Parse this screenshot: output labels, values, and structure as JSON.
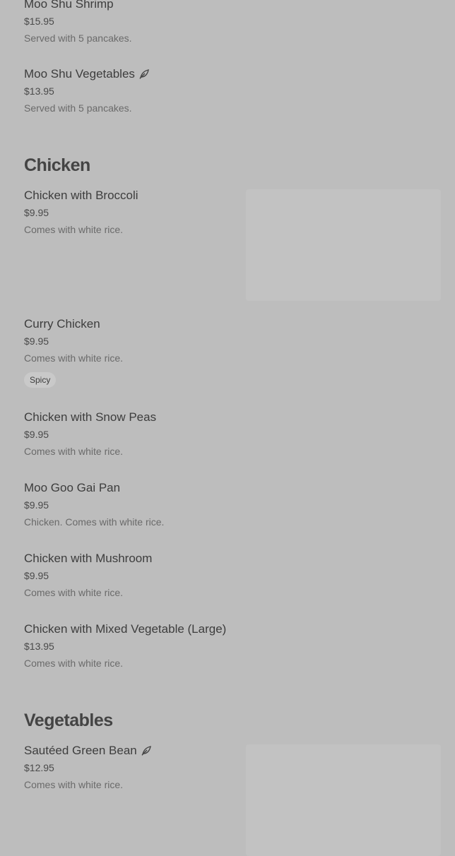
{
  "sections": [
    {
      "items": [
        {
          "name": "Moo Shu Shrimp",
          "price": "$15.95",
          "description": "Served with 5 pancakes."
        },
        {
          "name": "Moo Shu Vegetables",
          "price": "$13.95",
          "description": "Served with 5 pancakes.",
          "icon": "leaf-icon"
        }
      ]
    },
    {
      "title": "Chicken",
      "items": [
        {
          "name": "Chicken with Broccoli",
          "price": "$9.95",
          "description": "Comes with white rice."
        },
        {
          "name": "Curry Chicken",
          "price": "$9.95",
          "description": "Comes with white rice.",
          "badge": "Spicy"
        },
        {
          "name": "Chicken with Snow Peas",
          "price": "$9.95",
          "description": "Comes with white rice."
        },
        {
          "name": "Moo Goo Gai Pan",
          "price": "$9.95",
          "description": "Chicken. Comes with white rice."
        },
        {
          "name": "Chicken with Mushroom",
          "price": "$9.95",
          "description": "Comes with white rice."
        },
        {
          "name": "Chicken with Mixed Vegetable (Large)",
          "price": "$13.95",
          "description": "Comes with white rice."
        }
      ]
    },
    {
      "title": "Vegetables",
      "items": [
        {
          "name": "Sautéed Green Bean",
          "price": "$12.95",
          "description": "Comes with white rice.",
          "icon": "leaf-icon"
        }
      ]
    }
  ],
  "colors": {
    "background": "#bdbdbd",
    "placeholder": "#c2c2c2",
    "badge": "#c9c9c9"
  }
}
